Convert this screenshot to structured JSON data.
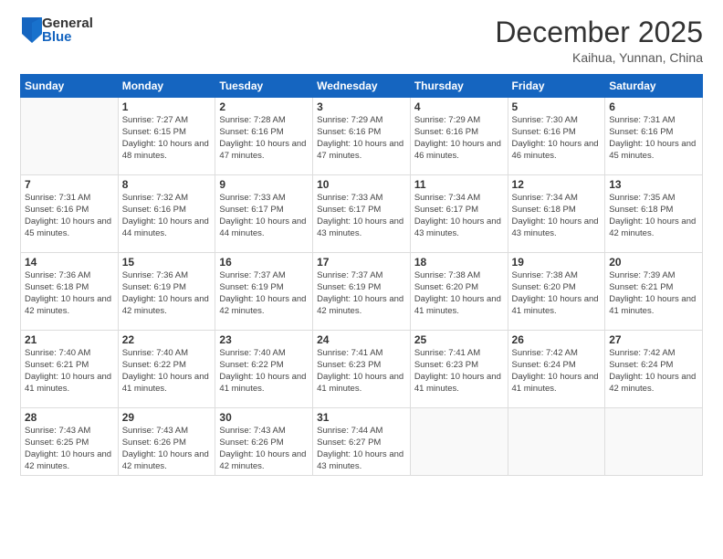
{
  "logo": {
    "general": "General",
    "blue": "Blue"
  },
  "title": "December 2025",
  "location": "Kaihua, Yunnan, China",
  "headers": [
    "Sunday",
    "Monday",
    "Tuesday",
    "Wednesday",
    "Thursday",
    "Friday",
    "Saturday"
  ],
  "weeks": [
    [
      {
        "day": "",
        "info": ""
      },
      {
        "day": "1",
        "info": "Sunrise: 7:27 AM\nSunset: 6:15 PM\nDaylight: 10 hours and 48 minutes."
      },
      {
        "day": "2",
        "info": "Sunrise: 7:28 AM\nSunset: 6:16 PM\nDaylight: 10 hours and 47 minutes."
      },
      {
        "day": "3",
        "info": "Sunrise: 7:29 AM\nSunset: 6:16 PM\nDaylight: 10 hours and 47 minutes."
      },
      {
        "day": "4",
        "info": "Sunrise: 7:29 AM\nSunset: 6:16 PM\nDaylight: 10 hours and 46 minutes."
      },
      {
        "day": "5",
        "info": "Sunrise: 7:30 AM\nSunset: 6:16 PM\nDaylight: 10 hours and 46 minutes."
      },
      {
        "day": "6",
        "info": "Sunrise: 7:31 AM\nSunset: 6:16 PM\nDaylight: 10 hours and 45 minutes."
      }
    ],
    [
      {
        "day": "7",
        "info": "Sunrise: 7:31 AM\nSunset: 6:16 PM\nDaylight: 10 hours and 45 minutes."
      },
      {
        "day": "8",
        "info": "Sunrise: 7:32 AM\nSunset: 6:16 PM\nDaylight: 10 hours and 44 minutes."
      },
      {
        "day": "9",
        "info": "Sunrise: 7:33 AM\nSunset: 6:17 PM\nDaylight: 10 hours and 44 minutes."
      },
      {
        "day": "10",
        "info": "Sunrise: 7:33 AM\nSunset: 6:17 PM\nDaylight: 10 hours and 43 minutes."
      },
      {
        "day": "11",
        "info": "Sunrise: 7:34 AM\nSunset: 6:17 PM\nDaylight: 10 hours and 43 minutes."
      },
      {
        "day": "12",
        "info": "Sunrise: 7:34 AM\nSunset: 6:18 PM\nDaylight: 10 hours and 43 minutes."
      },
      {
        "day": "13",
        "info": "Sunrise: 7:35 AM\nSunset: 6:18 PM\nDaylight: 10 hours and 42 minutes."
      }
    ],
    [
      {
        "day": "14",
        "info": "Sunrise: 7:36 AM\nSunset: 6:18 PM\nDaylight: 10 hours and 42 minutes."
      },
      {
        "day": "15",
        "info": "Sunrise: 7:36 AM\nSunset: 6:19 PM\nDaylight: 10 hours and 42 minutes."
      },
      {
        "day": "16",
        "info": "Sunrise: 7:37 AM\nSunset: 6:19 PM\nDaylight: 10 hours and 42 minutes."
      },
      {
        "day": "17",
        "info": "Sunrise: 7:37 AM\nSunset: 6:19 PM\nDaylight: 10 hours and 42 minutes."
      },
      {
        "day": "18",
        "info": "Sunrise: 7:38 AM\nSunset: 6:20 PM\nDaylight: 10 hours and 41 minutes."
      },
      {
        "day": "19",
        "info": "Sunrise: 7:38 AM\nSunset: 6:20 PM\nDaylight: 10 hours and 41 minutes."
      },
      {
        "day": "20",
        "info": "Sunrise: 7:39 AM\nSunset: 6:21 PM\nDaylight: 10 hours and 41 minutes."
      }
    ],
    [
      {
        "day": "21",
        "info": "Sunrise: 7:40 AM\nSunset: 6:21 PM\nDaylight: 10 hours and 41 minutes."
      },
      {
        "day": "22",
        "info": "Sunrise: 7:40 AM\nSunset: 6:22 PM\nDaylight: 10 hours and 41 minutes."
      },
      {
        "day": "23",
        "info": "Sunrise: 7:40 AM\nSunset: 6:22 PM\nDaylight: 10 hours and 41 minutes."
      },
      {
        "day": "24",
        "info": "Sunrise: 7:41 AM\nSunset: 6:23 PM\nDaylight: 10 hours and 41 minutes."
      },
      {
        "day": "25",
        "info": "Sunrise: 7:41 AM\nSunset: 6:23 PM\nDaylight: 10 hours and 41 minutes."
      },
      {
        "day": "26",
        "info": "Sunrise: 7:42 AM\nSunset: 6:24 PM\nDaylight: 10 hours and 41 minutes."
      },
      {
        "day": "27",
        "info": "Sunrise: 7:42 AM\nSunset: 6:24 PM\nDaylight: 10 hours and 42 minutes."
      }
    ],
    [
      {
        "day": "28",
        "info": "Sunrise: 7:43 AM\nSunset: 6:25 PM\nDaylight: 10 hours and 42 minutes."
      },
      {
        "day": "29",
        "info": "Sunrise: 7:43 AM\nSunset: 6:26 PM\nDaylight: 10 hours and 42 minutes."
      },
      {
        "day": "30",
        "info": "Sunrise: 7:43 AM\nSunset: 6:26 PM\nDaylight: 10 hours and 42 minutes."
      },
      {
        "day": "31",
        "info": "Sunrise: 7:44 AM\nSunset: 6:27 PM\nDaylight: 10 hours and 43 minutes."
      },
      {
        "day": "",
        "info": ""
      },
      {
        "day": "",
        "info": ""
      },
      {
        "day": "",
        "info": ""
      }
    ]
  ]
}
